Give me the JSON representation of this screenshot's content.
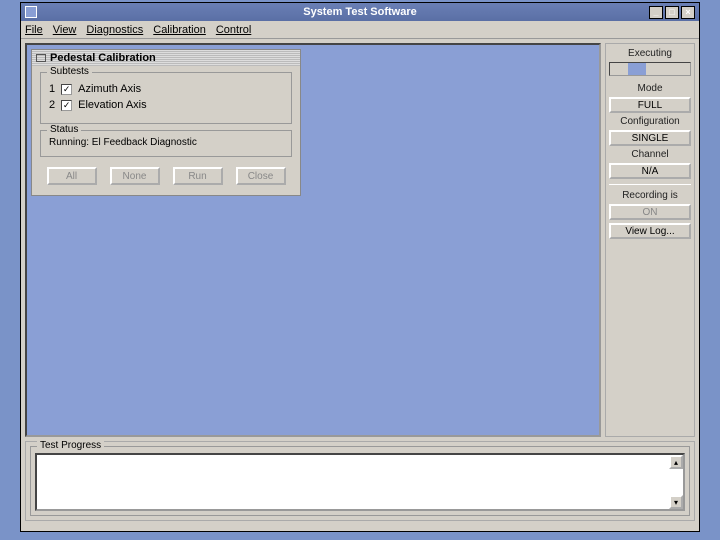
{
  "titlebar": {
    "title": "System Test Software"
  },
  "menu": {
    "file": "File",
    "view": "View",
    "diagnostics": "Diagnostics",
    "calibration": "Calibration",
    "control": "Control"
  },
  "side": {
    "executing": "Executing",
    "mode": "Mode",
    "mode_val": "FULL",
    "config": "Configuration",
    "config_val": "SINGLE",
    "channel": "Channel",
    "channel_val": "N/A",
    "recording": "Recording is",
    "recording_val": "ON",
    "viewlog": "View Log..."
  },
  "dialog": {
    "title": "Pedestal Calibration",
    "subtests_legend": "Subtests",
    "subtests": [
      {
        "num": "1",
        "label": "Azimuth Axis"
      },
      {
        "num": "2",
        "label": "Elevation Axis"
      }
    ],
    "status_legend": "Status",
    "status_text": "Running: El Feedback Diagnostic",
    "btn_all": "All",
    "btn_none": "None",
    "btn_run": "Run",
    "btn_close": "Close"
  },
  "bottom": {
    "legend": "Test Progress"
  }
}
